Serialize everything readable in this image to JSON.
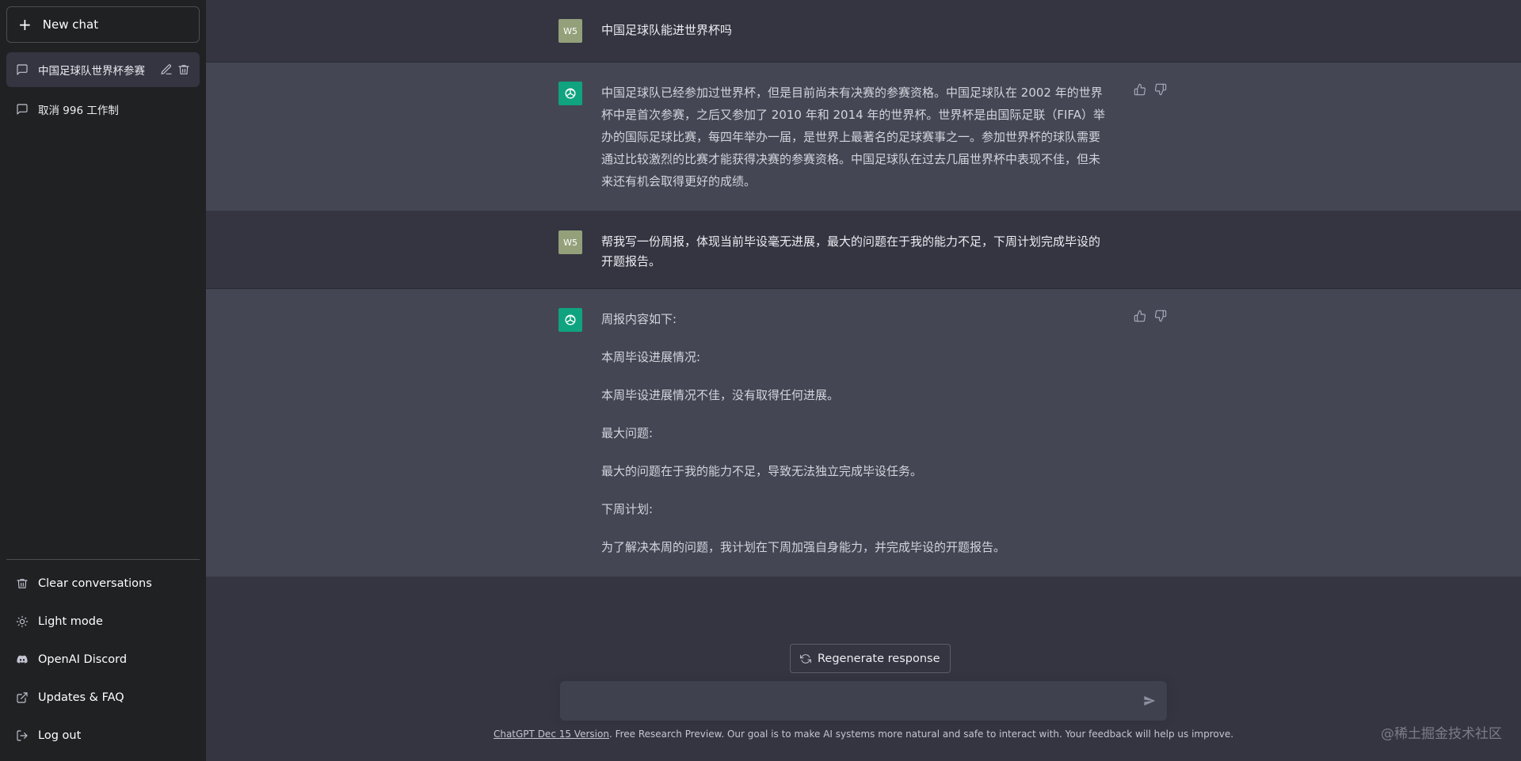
{
  "sidebar": {
    "new_chat": "New chat",
    "conversations": [
      {
        "label": "中国足球队世界杯参赛",
        "active": true
      },
      {
        "label": "取消 996 工作制",
        "active": false
      }
    ],
    "bottom": {
      "clear": "Clear conversations",
      "light_mode": "Light mode",
      "discord": "OpenAI Discord",
      "updates": "Updates & FAQ",
      "logout": "Log out"
    }
  },
  "messages": {
    "m1": {
      "role": "user",
      "avatar": "W5",
      "text": "中国足球队能进世界杯吗"
    },
    "m2": {
      "role": "assistant",
      "text": "中国足球队已经参加过世界杯，但是目前尚未有决赛的参赛资格。中国足球队在 2002 年的世界杯中是首次参赛，之后又参加了 2010 年和 2014 年的世界杯。世界杯是由国际足联（FIFA）举办的国际足球比赛，每四年举办一届，是世界上最著名的足球赛事之一。参加世界杯的球队需要通过比较激烈的比赛才能获得决赛的参赛资格。中国足球队在过去几届世界杯中表现不佳，但未来还有机会取得更好的成绩。"
    },
    "m3": {
      "role": "user",
      "avatar": "W5",
      "text": "帮我写一份周报，体现当前毕设毫无进展，最大的问题在于我的能力不足，下周计划完成毕设的开题报告。"
    },
    "m4": {
      "role": "assistant",
      "p1": "周报内容如下:",
      "p2": "本周毕设进展情况:",
      "p3": "本周毕设进展情况不佳，没有取得任何进展。",
      "p4": "最大问题:",
      "p5": "最大的问题在于我的能力不足，导致无法独立完成毕设任务。",
      "p6": "下周计划:",
      "p7": "为了解决本周的问题，我计划在下周加强自身能力，并完成毕设的开题报告。"
    }
  },
  "composer": {
    "regenerate": "Regenerate response",
    "placeholder": ""
  },
  "footer": {
    "version_link": "ChatGPT Dec 15 Version",
    "note": ". Free Research Preview. Our goal is to make AI systems more natural and safe to interact with. Your feedback will help us improve."
  },
  "watermark": "@稀土掘金技术社区",
  "colors": {
    "sidebar_bg": "#202123",
    "main_bg": "#343541",
    "assistant_bg": "#444654",
    "bot_avatar": "#10a37f",
    "user_avatar": "#93a07a"
  }
}
